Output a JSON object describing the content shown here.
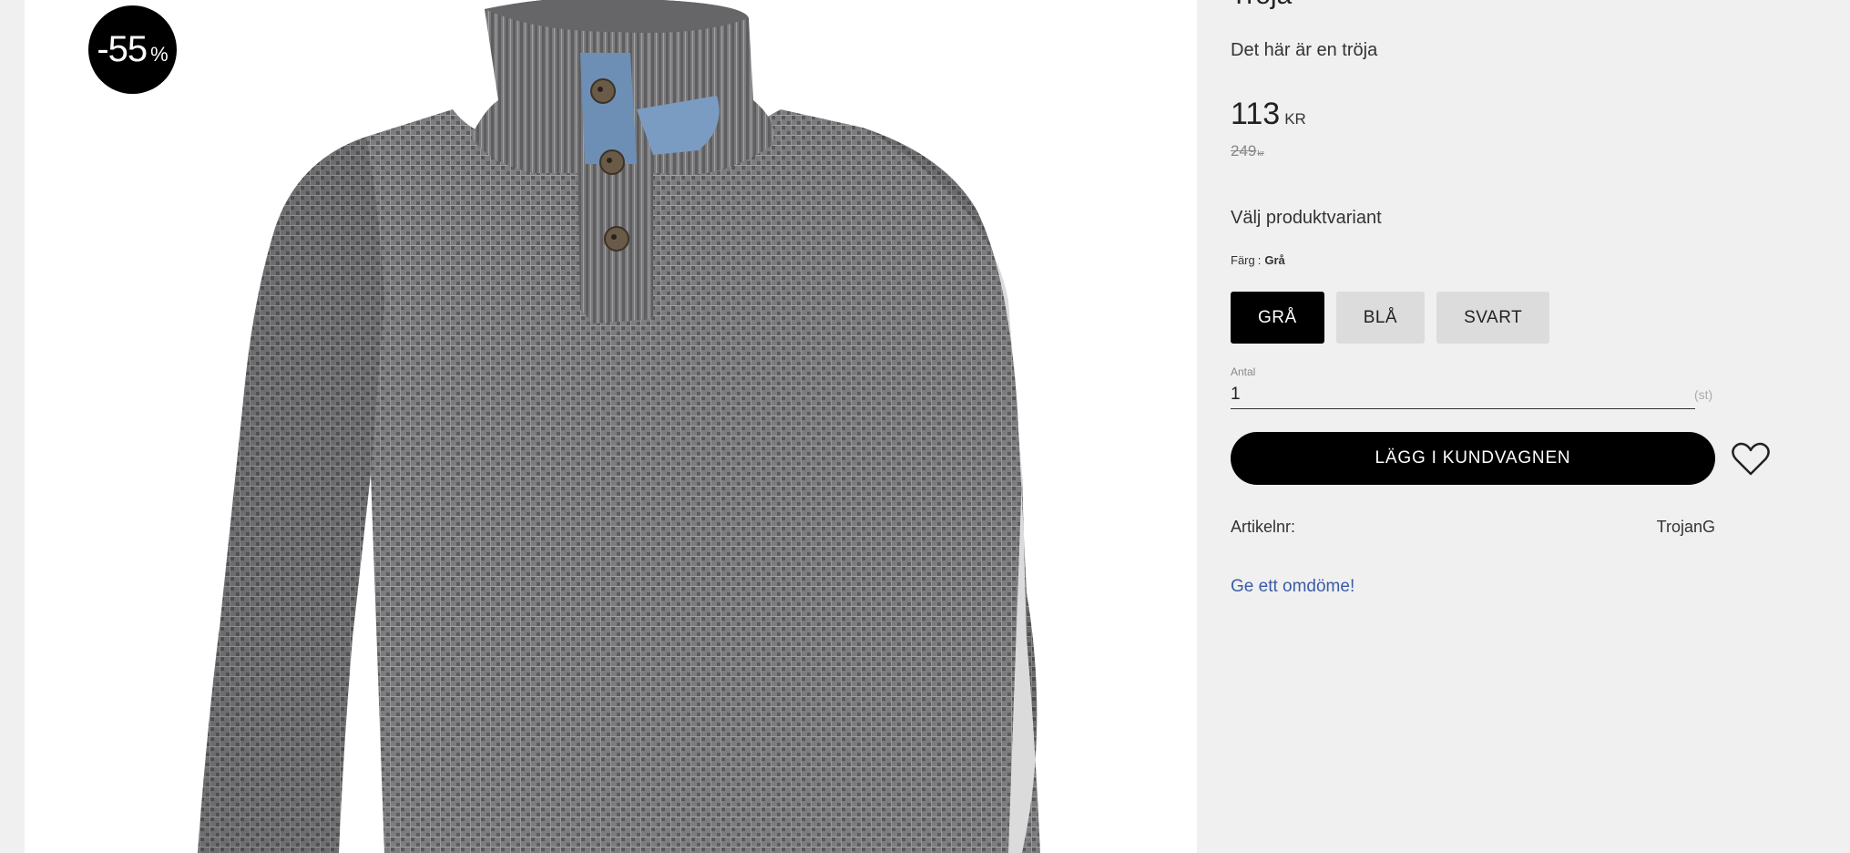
{
  "product": {
    "title_fragment": "Tröja",
    "description": "Det här är en tröja",
    "discount_badge": {
      "value": "-55",
      "unit": "%"
    },
    "price": {
      "amount": "113",
      "currency": "KR"
    },
    "old_price": {
      "amount": "249",
      "currency": "kr"
    },
    "image_icon": "sweater-photo"
  },
  "variant_section": {
    "heading": "Välj produktvariant",
    "color_label": "Färg",
    "color_separator": ":",
    "color_value": "Grå",
    "options": [
      "GRÅ",
      "BLÅ",
      "SVART"
    ],
    "selected_index": 0
  },
  "quantity": {
    "label": "Antal",
    "value": "1",
    "unit": "(st)"
  },
  "cart": {
    "add_label": "LÄGG I KUNDVAGNEN",
    "wishlist_icon": "heart-icon"
  },
  "article": {
    "label": "Artikelnr:",
    "value": "TrojanG"
  },
  "review": {
    "link_label": "Ge ett omdöme!"
  },
  "colors": {
    "background": "#f0f0f0",
    "accent": "#000000",
    "variant_bg": "#dcdcdc",
    "link": "#3b5aa8"
  }
}
